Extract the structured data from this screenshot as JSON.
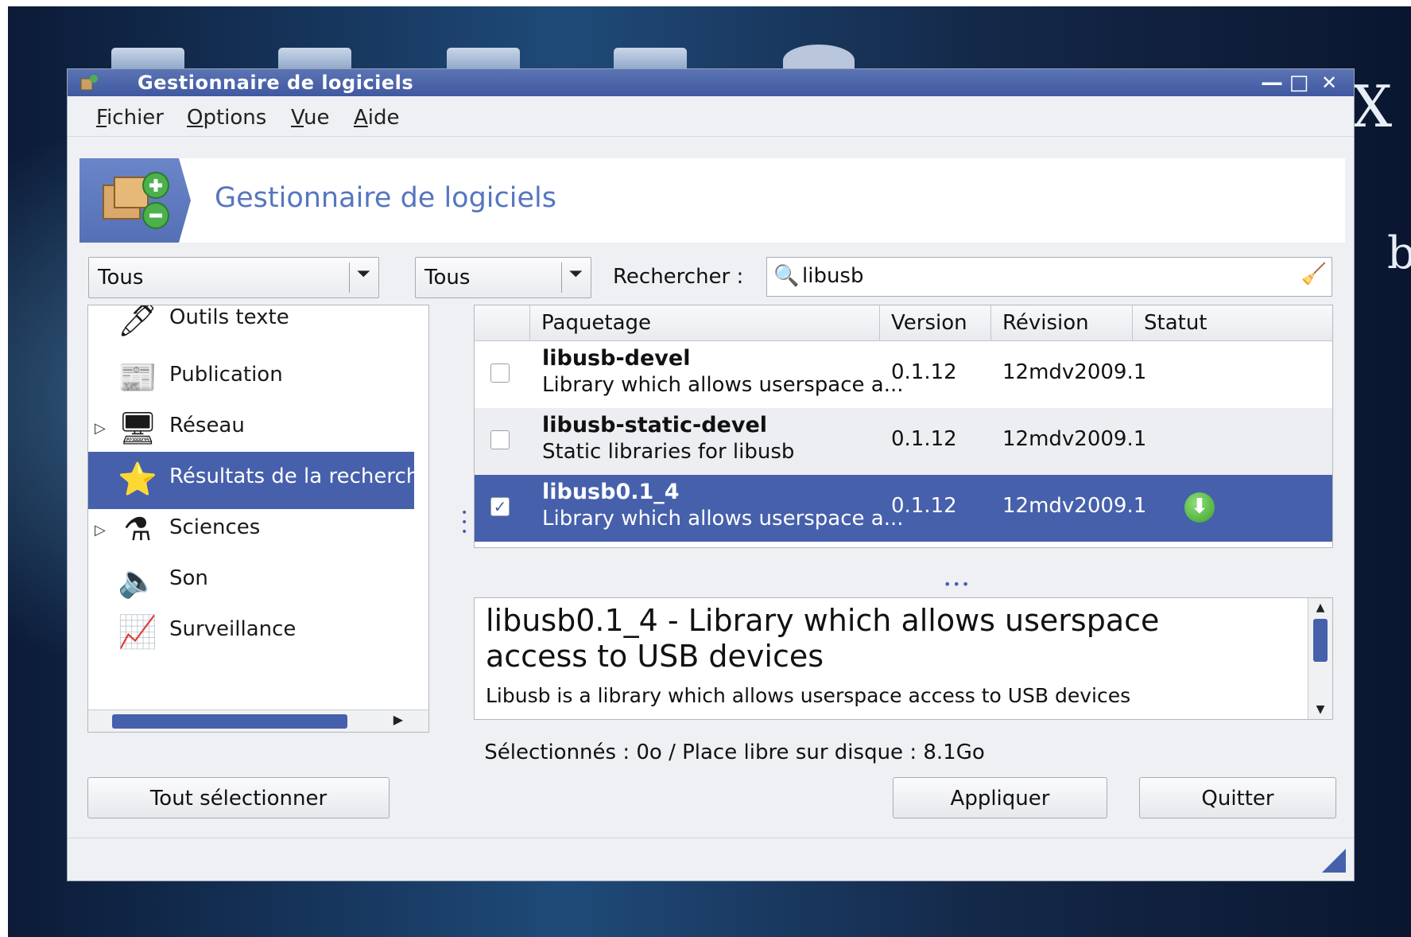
{
  "window": {
    "title": "Gestionnaire de logiciels",
    "controls": {
      "minimize": "—",
      "maximize": "□",
      "close": "✕"
    }
  },
  "menu": [
    {
      "first": "F",
      "rest": "ichier"
    },
    {
      "first": "O",
      "rest": "ptions"
    },
    {
      "first": "V",
      "rest": "ue"
    },
    {
      "first": "A",
      "rest": "ide"
    }
  ],
  "banner": {
    "title": "Gestionnaire de logiciels"
  },
  "filters": {
    "combo1": "Tous",
    "combo2": "Tous",
    "search_label": "Rechercher :",
    "search_value": "libusb"
  },
  "categories": [
    {
      "label": "Outils texte",
      "icon": "pen-icon"
    },
    {
      "label": "Publication",
      "icon": "publication-icon"
    },
    {
      "label": "Réseau",
      "icon": "network-icon",
      "expandable": true
    },
    {
      "label": "Résultats de la recherche",
      "icon": "star-icon",
      "selected": true
    },
    {
      "label": "Sciences",
      "icon": "science-icon",
      "expandable": true
    },
    {
      "label": "Son",
      "icon": "speaker-icon"
    },
    {
      "label": "Surveillance",
      "icon": "monitor-icon"
    }
  ],
  "packages": {
    "columns": [
      "Paquetage",
      "Version",
      "Révision",
      "Statut"
    ],
    "rows": [
      {
        "name": "libusb-devel",
        "desc": "Library which allows userspace a...",
        "version": "0.1.12",
        "revision": "12mdv2009.1",
        "checked": false,
        "status": ""
      },
      {
        "name": "libusb-static-devel",
        "desc": "Static libraries for libusb",
        "version": "0.1.12",
        "revision": "12mdv2009.1",
        "checked": false,
        "status": ""
      },
      {
        "name": "libusb0.1_4",
        "desc": "Library which allows userspace a...",
        "version": "0.1.12",
        "revision": "12mdv2009.1",
        "checked": true,
        "status": "install-icon",
        "selected": true
      }
    ]
  },
  "details": {
    "title": "libusb0.1_4 - Library which allows userspace access to USB devices",
    "body": "Libusb is a library which allows userspace access to USB devices"
  },
  "status": "Sélectionnés : 0o / Place libre sur disque : 8.1Go",
  "buttons": {
    "select_all": "Tout sélectionner",
    "apply": "Appliquer",
    "quit": "Quitter"
  },
  "desktop": {
    "glyph1": "X",
    "glyph2": "b"
  },
  "colors": {
    "selection": "#4660ac",
    "titlebar": "#4b64aa",
    "banner_text": "#5576c0"
  }
}
